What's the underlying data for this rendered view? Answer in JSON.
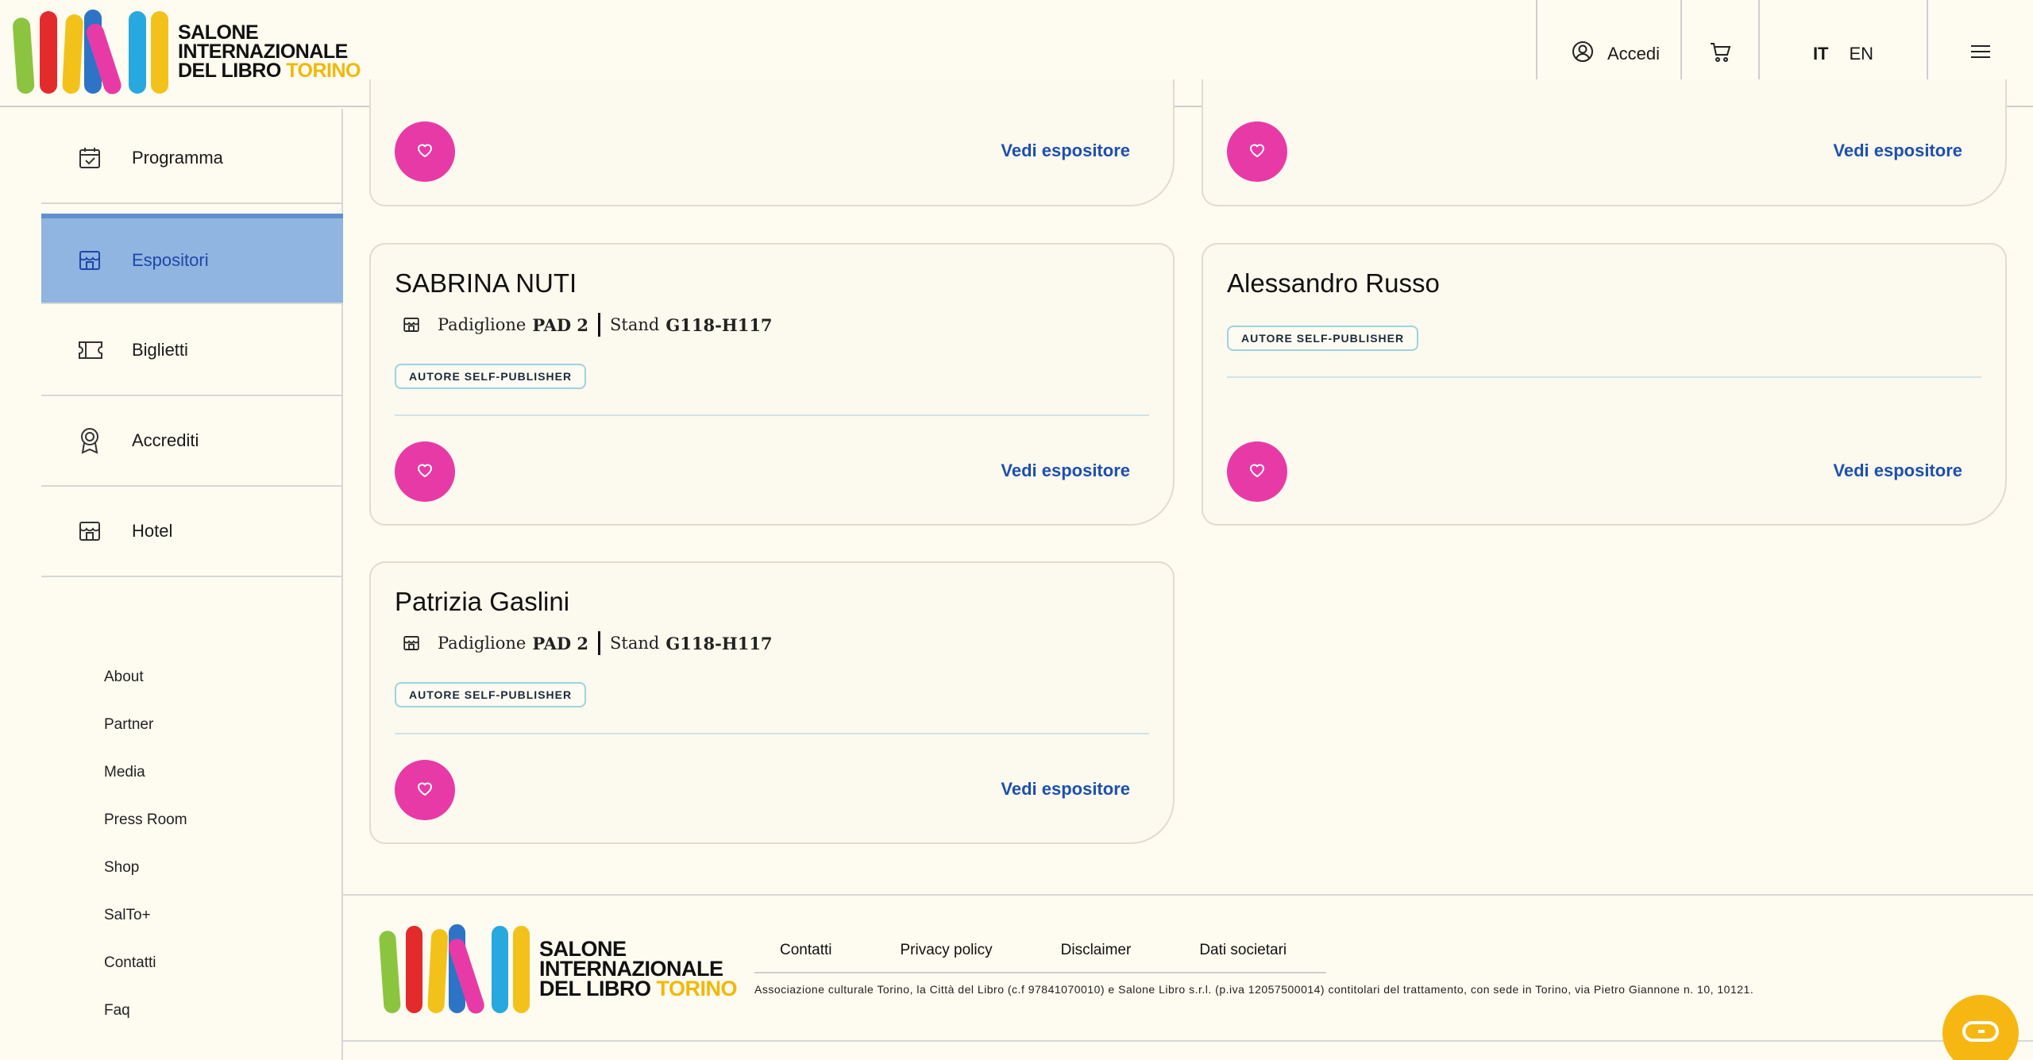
{
  "brand": {
    "line1": "SALONE",
    "line2": "INTERNAZIONALE",
    "line3a": "DEL LIBRO",
    "line3b": "TORINO",
    "colors": [
      "#8bc53f",
      "#e42b2b",
      "#f3c21a",
      "#2d74c6",
      "#e83aa6",
      "#27a9df",
      "#f3c21a"
    ]
  },
  "header": {
    "login_label": "Accedi",
    "lang_it": "IT",
    "lang_en": "EN",
    "icons": [
      "user-icon",
      "cart-icon",
      "menu-icon"
    ]
  },
  "sidebar": {
    "items": [
      {
        "label": "Programma",
        "icon": "calendar-check-icon"
      },
      {
        "label": "Espositori",
        "icon": "store-icon",
        "active": true
      },
      {
        "label": "Biglietti",
        "icon": "ticket-icon"
      },
      {
        "label": "Accrediti",
        "icon": "badge-icon"
      },
      {
        "label": "Hotel",
        "icon": "store-icon"
      }
    ],
    "links": [
      "About",
      "Partner",
      "Media",
      "Press Room",
      "Shop",
      "SalTo+",
      "Contatti",
      "Faq"
    ]
  },
  "cards": {
    "vedi_label": "Vedi espositore",
    "top": [
      {},
      {}
    ],
    "items": [
      {
        "title": "SABRINA NUTI",
        "pad_label": "Padiglione",
        "pad": "PAD 2",
        "stand_label": "Stand",
        "stand": "G118-H117",
        "badge": "AUTORE SELF-PUBLISHER"
      },
      {
        "title": "Alessandro Russo",
        "badge": "AUTORE SELF-PUBLISHER"
      },
      {
        "title": "Patrizia Gaslini",
        "pad_label": "Padiglione",
        "pad": "PAD 2",
        "stand_label": "Stand",
        "stand": "G118-H117",
        "badge": "AUTORE SELF-PUBLISHER"
      }
    ]
  },
  "footer": {
    "links": [
      "Contatti",
      "Privacy policy",
      "Disclaimer",
      "Dati societari"
    ],
    "legal": "Associazione culturale Torino, la Città del Libro (c.f 97841070010) e Salone Libro s.r.l. (p.iva 12057500014) contitolari del trattamento, con sede in Torino, via Pietro Giannone n. 10, 10121."
  },
  "accent": {
    "heart": "#e83aa6",
    "link": "#1c50b0",
    "active_nav": "#8fb5e0",
    "chat": "#f7b712"
  }
}
